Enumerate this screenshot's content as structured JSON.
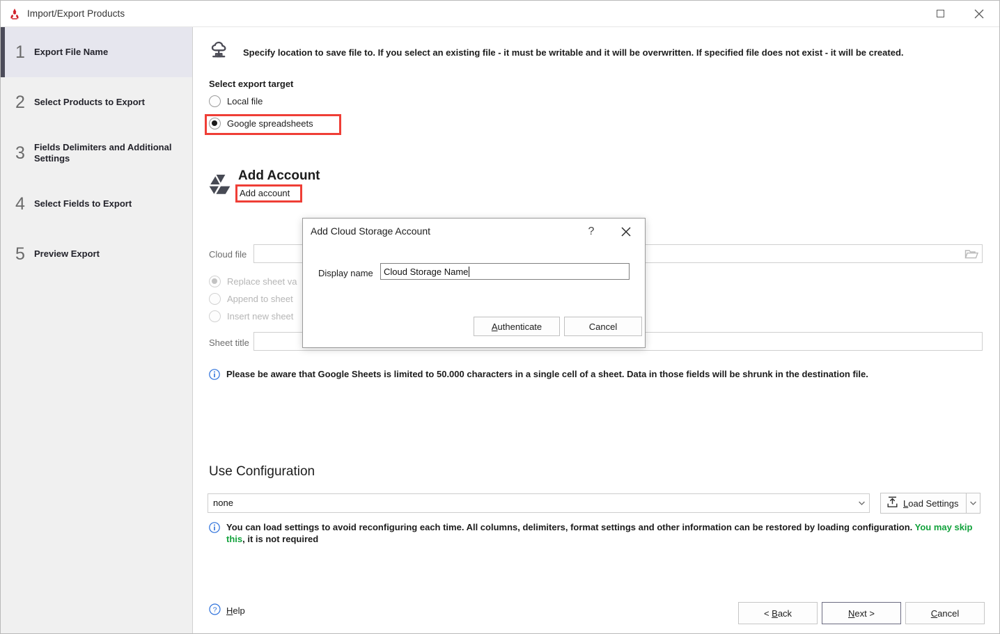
{
  "window": {
    "title": "Import/Export Products",
    "app_icon": "app-logo-icon",
    "maximize_label": "Maximize",
    "close_label": "Close"
  },
  "sidebar": {
    "steps": [
      {
        "num": "1",
        "label": "Export File Name",
        "active": true
      },
      {
        "num": "2",
        "label": "Select Products to Export",
        "active": false
      },
      {
        "num": "3",
        "label": "Fields Delimiters and Additional Settings",
        "active": false
      },
      {
        "num": "4",
        "label": "Select Fields to Export",
        "active": false
      },
      {
        "num": "5",
        "label": "Preview Export",
        "active": false
      }
    ]
  },
  "main": {
    "hint": "Specify location to save file to. If you select an existing file - it must be writable and it will be overwritten. If specified file does not exist - it will be created.",
    "export_target_label": "Select export target",
    "targets": [
      {
        "label": "Local file",
        "selected": false
      },
      {
        "label": "Google spreadsheets",
        "selected": true
      }
    ],
    "account": {
      "title": "Add Account",
      "link": "Add account",
      "icon": "google-drive-icon"
    },
    "cloud_file_label": "Cloud file",
    "cloud_file_value": "",
    "sheet_modes": [
      {
        "label": "Replace sheet va",
        "selected": true
      },
      {
        "label": "Append to sheet",
        "selected": false
      },
      {
        "label": "Insert new sheet",
        "selected": false
      }
    ],
    "sheet_title_label": "Sheet title",
    "sheet_title_value": "",
    "sheets_notice": "Please be aware that Google Sheets is limited to 50.000 characters in a single cell of a sheet. Data in those fields will be shrunk in the destination file.",
    "use_configuration": {
      "title": "Use Configuration",
      "value": "none",
      "load_settings_label": "Load Settings",
      "notice_prefix": "You can ",
      "notice_bold1": "load settings",
      "notice_mid": " to avoid reconfiguring each time. All columns, delimiters, format settings and other information can be restored by loading configuration. ",
      "notice_green": "You may skip this",
      "notice_suffix": ", it is not required"
    }
  },
  "footer": {
    "help_label": "Help",
    "back_label": "< Back",
    "next_label": "Next >",
    "cancel_label": "Cancel"
  },
  "dialog": {
    "title": "Add Cloud Storage Account",
    "help_glyph": "?",
    "display_name_label": "Display name",
    "display_name_value": "Cloud Storage Name",
    "authenticate_label": "Authenticate",
    "cancel_label": "Cancel"
  },
  "colors": {
    "annotation_red": "#ef3e36",
    "accent_green": "#12a23c",
    "info_blue": "#2a6fdb",
    "sidebar_bg": "#f0f0f0",
    "active_step_bg": "#e6e6ee"
  }
}
